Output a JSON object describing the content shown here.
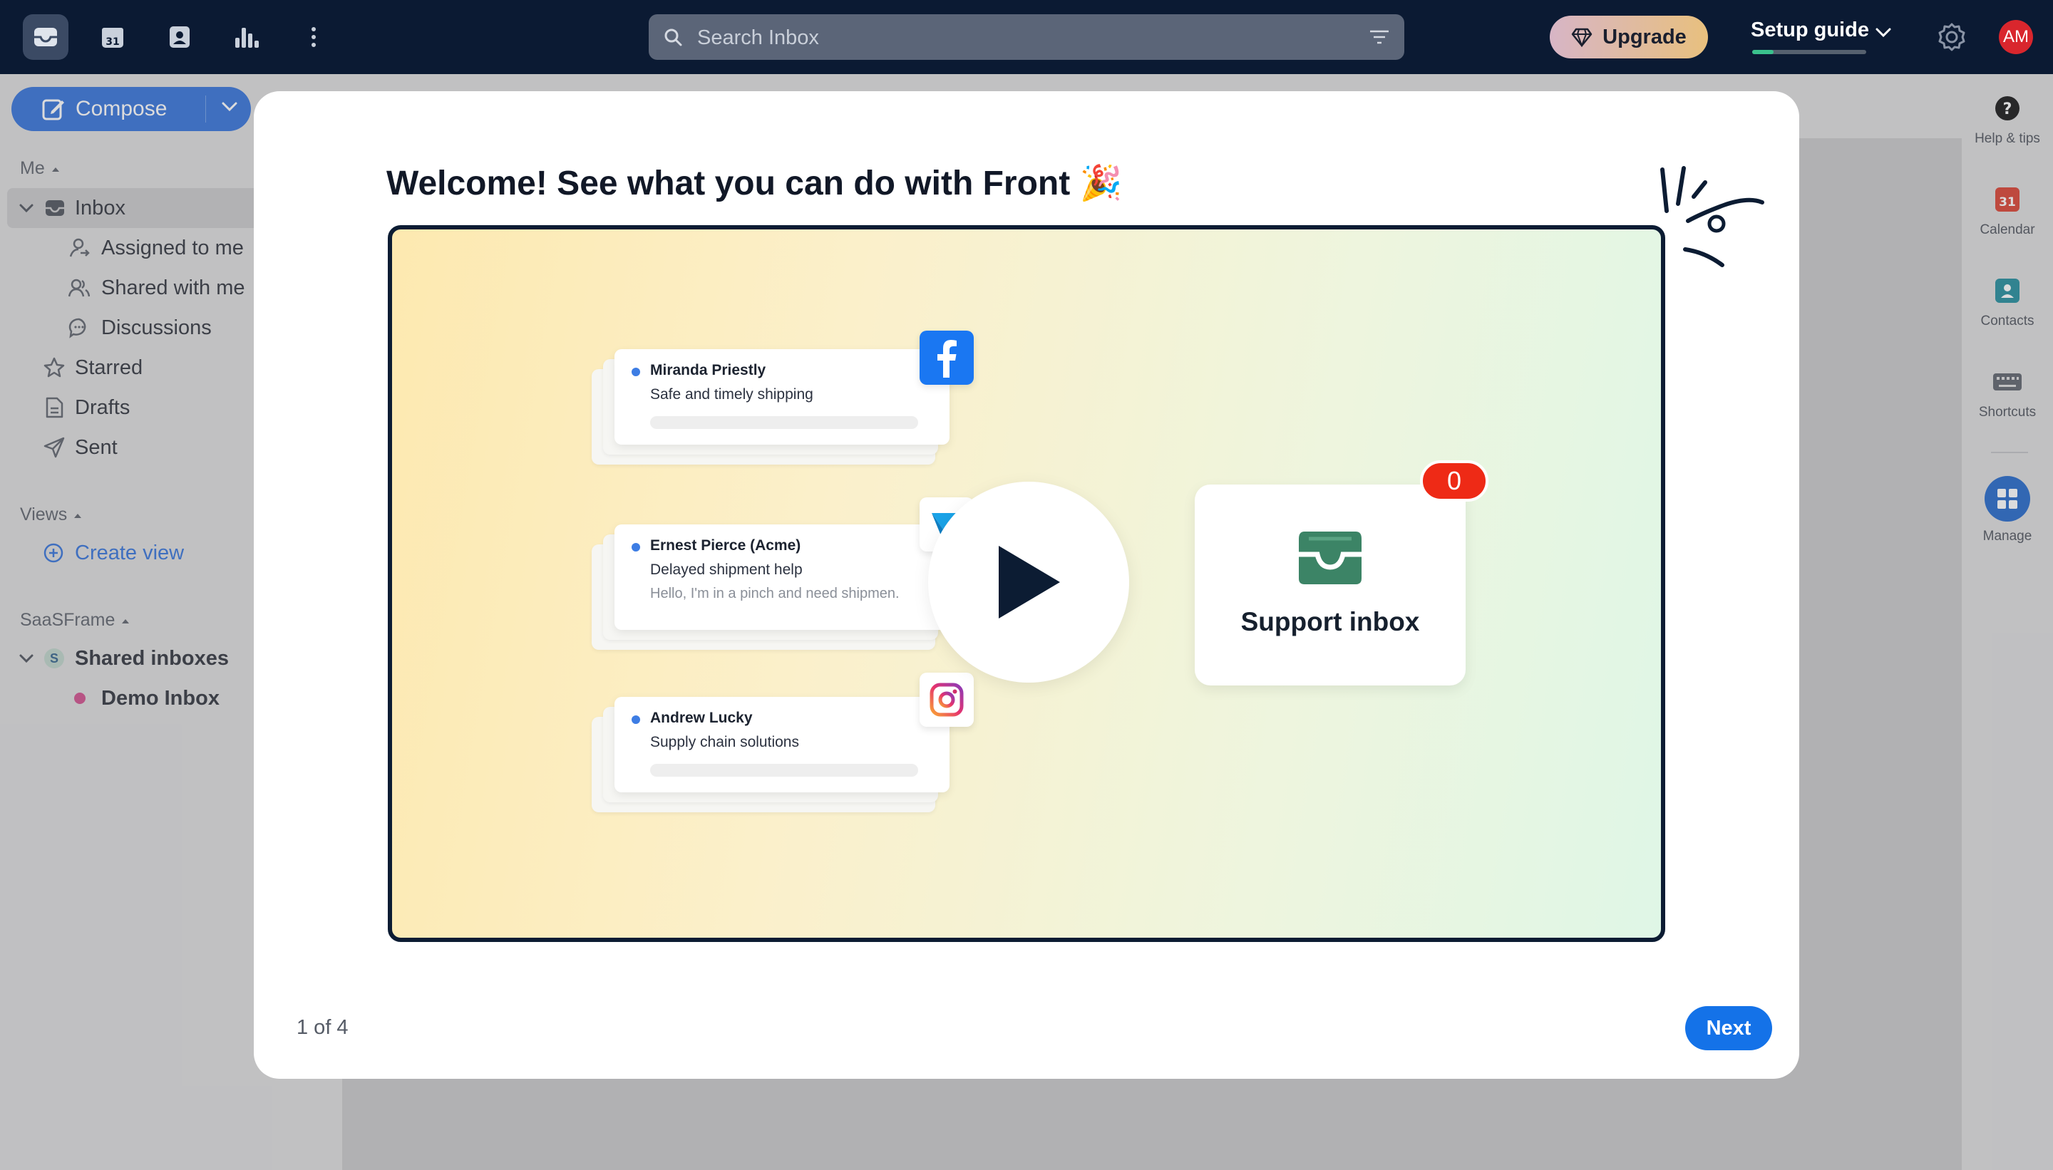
{
  "topbar": {
    "search_placeholder": "Search Inbox",
    "upgrade_label": "Upgrade",
    "setup_label": "Setup guide",
    "avatar_initials": "AM",
    "calendar_day": "31"
  },
  "sidebar": {
    "compose_label": "Compose",
    "me_label": "Me",
    "items": [
      {
        "label": "Inbox"
      },
      {
        "label": "Assigned to me"
      },
      {
        "label": "Shared with me"
      },
      {
        "label": "Discussions"
      },
      {
        "label": "Starred"
      },
      {
        "label": "Drafts"
      },
      {
        "label": "Sent"
      }
    ],
    "views_label": "Views",
    "create_view_label": "Create view",
    "team_label": "SaaSFrame",
    "team_avatar": "S",
    "shared_inboxes_label": "Shared inboxes",
    "demo_inbox_label": "Demo Inbox"
  },
  "rail": {
    "help_label": "Help & tips",
    "calendar_label": "Calendar",
    "calendar_day": "31",
    "contacts_label": "Contacts",
    "shortcuts_label": "Shortcuts",
    "manage_label": "Manage"
  },
  "modal": {
    "title": "Welcome! See what you can do with Front",
    "title_emoji": "🎉",
    "cards": [
      {
        "name": "Miranda Priestly",
        "subject": "Safe and timely shipping",
        "preview": ""
      },
      {
        "name": "Ernest Pierce (Acme)",
        "subject": "Delayed shipment help",
        "preview": "Hello, I'm in a pinch and need shipmen."
      },
      {
        "name": "Andrew Lucky",
        "subject": "Supply chain solutions",
        "preview": ""
      }
    ],
    "support_label": "Support inbox",
    "badge_count": "0",
    "pager": "1 of 4",
    "next_label": "Next"
  },
  "colors": {
    "topbar": "#0b1a33",
    "accent": "#1472e8",
    "compose": "#2f6fd9",
    "badge": "#ee2a16",
    "support_icon": "#3c8466"
  },
  "icons": [
    "inbox-icon",
    "calendar-icon",
    "contacts-icon",
    "analytics-icon",
    "more-icon",
    "search-icon",
    "filter-icon",
    "diamond-icon",
    "chevron-down-icon",
    "gear-icon",
    "compose-icon",
    "facebook-icon",
    "messenger-icon",
    "instagram-icon",
    "play-icon",
    "tray-icon",
    "help-icon",
    "keyboard-icon",
    "grid-icon"
  ]
}
